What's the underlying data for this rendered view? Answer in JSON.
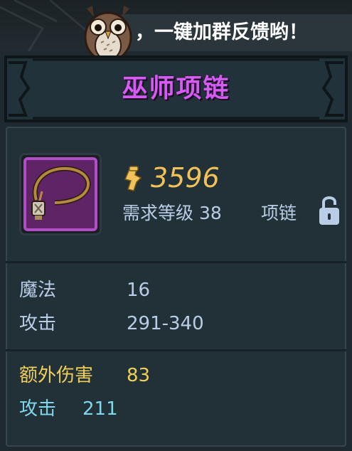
{
  "banner": {
    "text": "，一键加群反馈哟！"
  },
  "item": {
    "name": "巫师项链",
    "price": "3596",
    "req_label": "需求等级",
    "req_level": "38",
    "type": "项链"
  },
  "stats": [
    {
      "label": "魔法",
      "value": "16"
    },
    {
      "label": "攻击",
      "value": "291-340"
    }
  ],
  "extra_stats": [
    {
      "label": "额外伤害",
      "value": "83"
    },
    {
      "label": "攻击",
      "value": "211"
    }
  ],
  "colors": {
    "title": "#d45cf0",
    "price": "#f1c25a",
    "base_stat": "#b9cde6",
    "extra_stat": "#f0cf59",
    "bonus_stat": "#7ed8ea",
    "rarity_frame": "#b14ec7"
  },
  "icons": {
    "price": "money-icon",
    "lock": "lock-icon",
    "mascot": "owl-icon",
    "item": "necklace-icon"
  }
}
